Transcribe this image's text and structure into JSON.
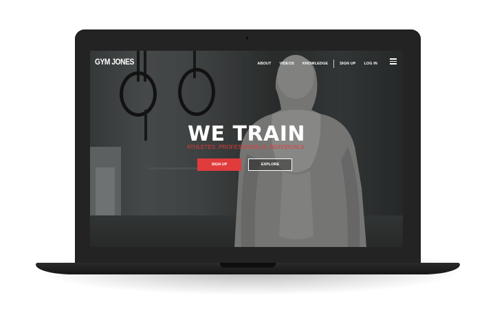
{
  "brand": {
    "logo": "GYM JONES"
  },
  "nav": {
    "links": [
      "ABOUT",
      "VIDEOS",
      "KNOWLEDGE"
    ],
    "account": [
      "SIGN UP",
      "LOG IN"
    ],
    "menu_icon": "hamburger-menu-icon"
  },
  "hero": {
    "title": "WE TRAIN",
    "subtitle": "ATHLETES. PROFESSIONALS. INDIVIDUALS.",
    "primary_button": "SIGN UP",
    "secondary_button": "EXPLORE"
  },
  "colors": {
    "accent": "#e03c3c",
    "laptop": "#232323",
    "text": "#ffffff"
  }
}
